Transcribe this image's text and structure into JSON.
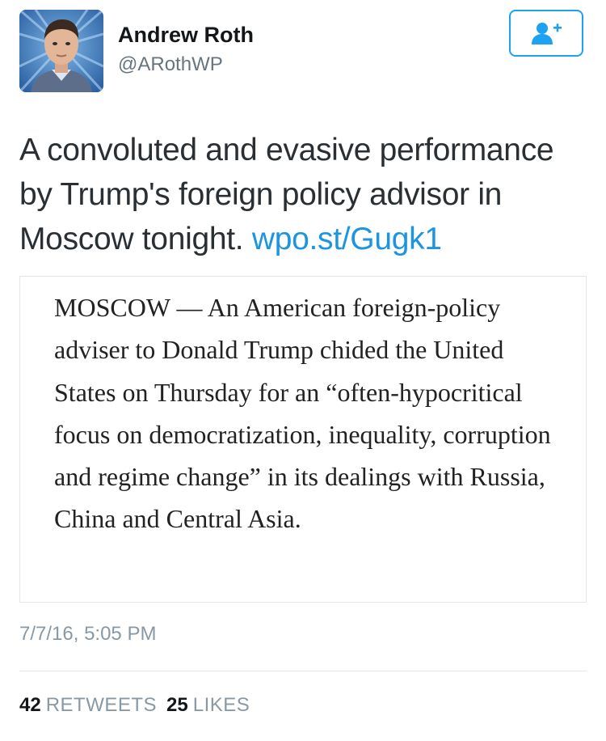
{
  "author": {
    "name": "Andrew Roth",
    "handle": "@ARothWP",
    "avatar_icon": "profile-photo"
  },
  "follow_button": {
    "icon": "follow-user-plus-icon",
    "color": "#1da1f2"
  },
  "tweet": {
    "text": "A convoluted and evasive performance by Trump's foreign policy advisor in Moscow tonight.",
    "link": "wpo.st/Gugk1",
    "link_color": "#1b95e0"
  },
  "quote_image": {
    "text": "MOSCOW — An American foreign-policy adviser to Donald Trump chided the United States on Thursday for an “often-hypocritical focus on democratization, inequality, corruption and regime change” in its dealings with Russia, China and Central Asia."
  },
  "timestamp": "7/7/16, 5:05 PM",
  "stats": {
    "retweets_count": "42",
    "retweets_label": "RETWEETS",
    "likes_count": "25",
    "likes_label": "LIKES"
  }
}
